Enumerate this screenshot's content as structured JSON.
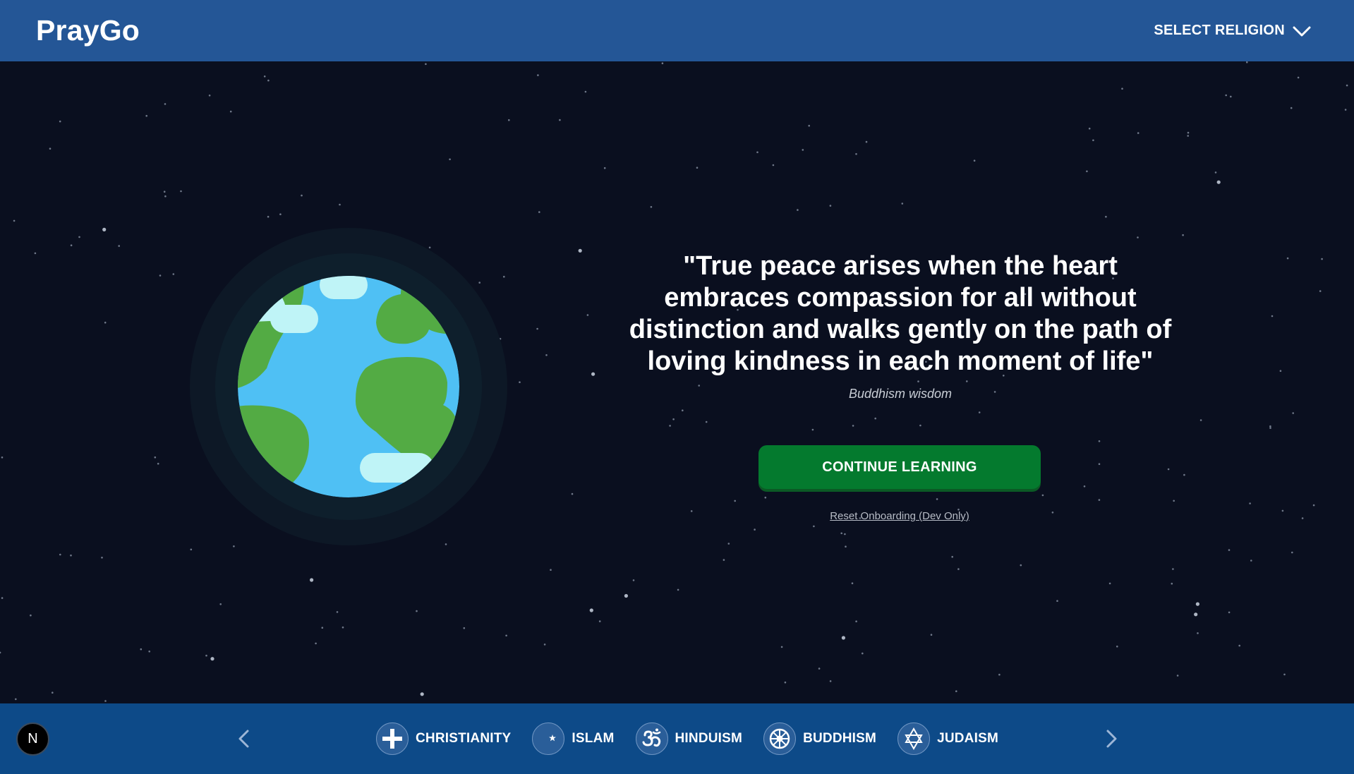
{
  "header": {
    "logo": "PrayGo",
    "religion_select_label": "SELECT RELIGION",
    "dropdown_icon": "chevron-down-icon"
  },
  "hero": {
    "quote": "\"True peace arises when the heart embraces compassion for all without distinction and walks gently on the path of loving kindness in each moment of life\"",
    "attribution": "Buddhism wisdom",
    "cta_label": "CONTINUE LEARNING",
    "reset_link": "Reset Onboarding (Dev Only)",
    "illustration": "globe-illustration"
  },
  "footer": {
    "dev_badge": "N",
    "prev_icon": "chevron-left-icon",
    "next_icon": "chevron-right-icon",
    "religions": [
      {
        "label": "CHRISTIANITY",
        "icon": "cross-icon"
      },
      {
        "label": "ISLAM",
        "icon": "crescent-star-icon"
      },
      {
        "label": "HINDUISM",
        "icon": "om-icon"
      },
      {
        "label": "BUDDHISM",
        "icon": "dharma-wheel-icon"
      },
      {
        "label": "JUDAISM",
        "icon": "star-of-david-icon"
      }
    ]
  },
  "colors": {
    "header_bg": "#245696",
    "background": "#0a0f1f",
    "cta_bg": "#047a2e",
    "footer_bg": "#0d4a88",
    "ocean": "#4fc0f4",
    "land": "#53ab44"
  }
}
